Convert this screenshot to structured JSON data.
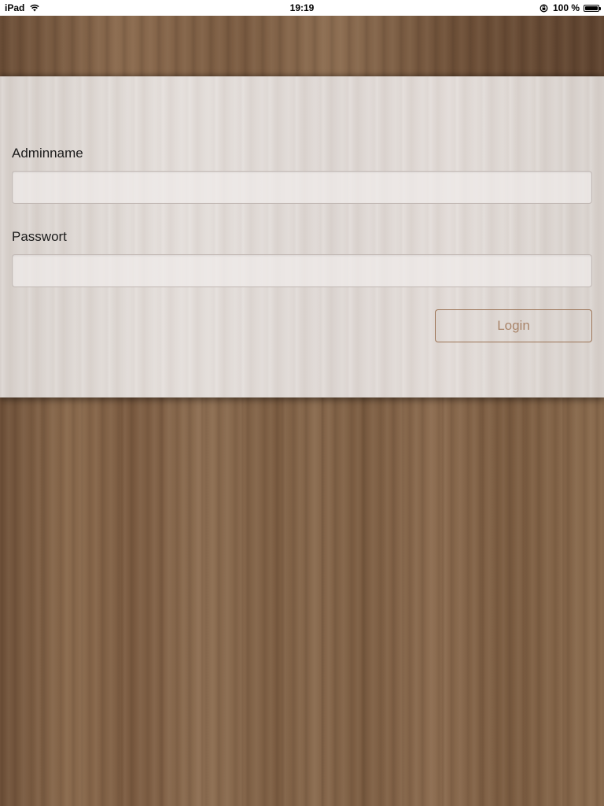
{
  "status_bar": {
    "device": "iPad",
    "time": "19:19",
    "battery_percent": "100 %",
    "icons": [
      "wifi-icon",
      "rotation-lock-icon",
      "battery-icon"
    ]
  },
  "login_form": {
    "admin_label": "Adminname",
    "admin_value": "",
    "password_label": "Passwort",
    "password_value": "",
    "login_button_label": "Login"
  },
  "colors": {
    "panel_background": "#ddd6d2",
    "button_border": "#9c7456",
    "button_text": "#a98469",
    "wood": "#7d5f45"
  }
}
